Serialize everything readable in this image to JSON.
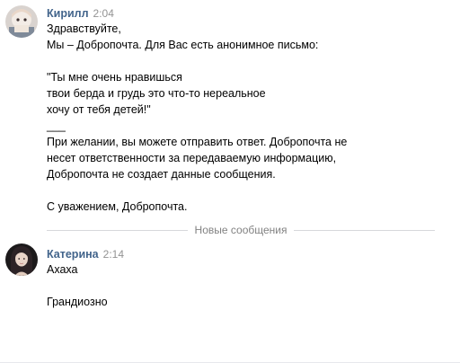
{
  "messages": [
    {
      "author": "Кирилл",
      "time": "2:04",
      "lines": [
        "Здравствуйте,",
        "Мы – Добропочта. Для Вас есть анонимное письмо:",
        "",
        "\"Ты мне очень нравишься",
        "твои берда и грудь это что-то нереальное",
        "хочу от тебя детей!\"",
        "___",
        "При желании, вы можете отправить ответ. Добропочта не",
        "несет ответственности за передаваемую информацию,",
        "Добропочта не создает данные сообщения.",
        "",
        "С уважением, Добропочта."
      ]
    },
    {
      "author": "Катерина",
      "time": "2:14",
      "lines": [
        "Ахаха",
        "",
        "Грандиозно"
      ]
    }
  ],
  "divider": {
    "label": "Новые сообщения"
  },
  "colors": {
    "author": "#42648b",
    "time": "#939393",
    "divider_text": "#828282",
    "divider_line": "#d7d8db"
  }
}
